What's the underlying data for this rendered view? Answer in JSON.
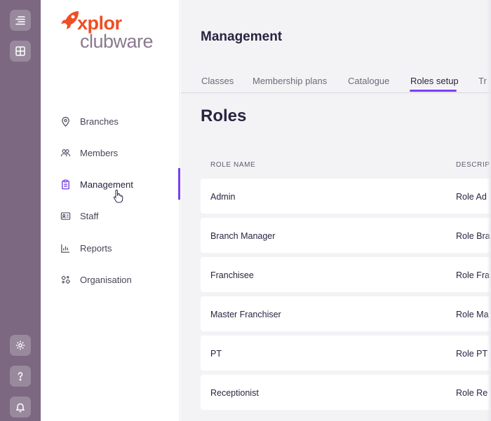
{
  "logo": {
    "line1": "xplor",
    "line2": "clubware"
  },
  "sidebar": {
    "items": [
      {
        "label": "Branches",
        "icon": "map-pin-icon"
      },
      {
        "label": "Members",
        "icon": "members-icon"
      },
      {
        "label": "Management",
        "icon": "clipboard-icon"
      },
      {
        "label": "Staff",
        "icon": "id-card-icon"
      },
      {
        "label": "Reports",
        "icon": "bar-chart-icon"
      },
      {
        "label": "Organisation",
        "icon": "org-icon"
      }
    ],
    "active": "Management"
  },
  "rail": {
    "top": [
      "menu-toggle-icon",
      "grid-icon"
    ],
    "bottom": [
      "settings-icon",
      "help-icon",
      "bell-icon"
    ]
  },
  "main": {
    "title": "Management",
    "tabs": [
      {
        "label": "Classes"
      },
      {
        "label": "Membership plans"
      },
      {
        "label": "Catalogue"
      },
      {
        "label": "Roles setup"
      },
      {
        "label": "Tr"
      }
    ],
    "active_tab": "Roles setup",
    "section_title": "Roles",
    "table": {
      "columns": [
        "ROLE NAME",
        "DESCRIP"
      ],
      "rows": [
        {
          "name": "Admin",
          "description": "Role Ad"
        },
        {
          "name": "Branch Manager",
          "description": "Role Bra"
        },
        {
          "name": "Franchisee",
          "description": "Role Fra"
        },
        {
          "name": "Master Franchiser",
          "description": "Role Ma"
        },
        {
          "name": "PT",
          "description": "Role PT"
        },
        {
          "name": "Receptionist",
          "description": "Role Re"
        }
      ]
    }
  },
  "colors": {
    "rail": "#7d6882",
    "accent": "#7b3ff2",
    "brand_orange": "#f04e23",
    "brand_gray": "#8a7a8e"
  }
}
